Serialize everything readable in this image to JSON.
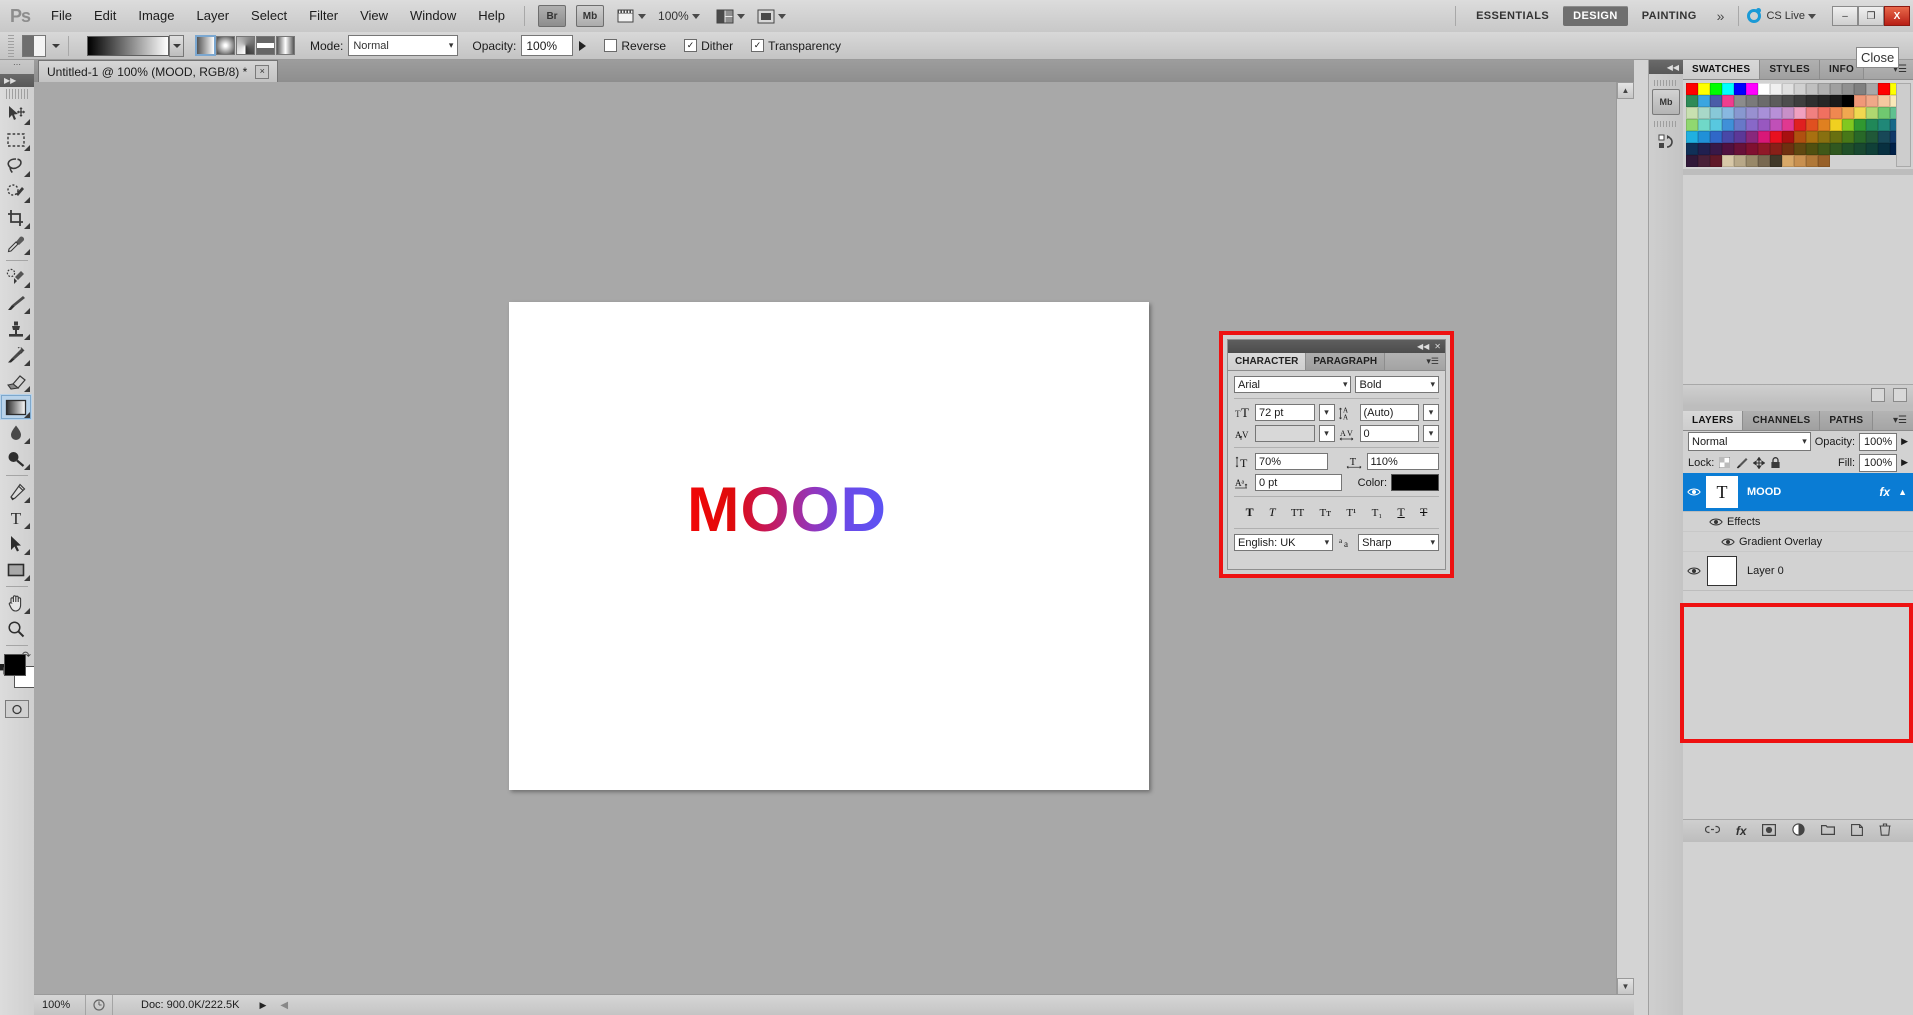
{
  "app": {
    "logo": "Ps",
    "menus": [
      "File",
      "Edit",
      "Image",
      "Layer",
      "Select",
      "Filter",
      "View",
      "Window",
      "Help"
    ],
    "bridge_label": "Br",
    "minibridge_label": "Mb",
    "zoom_level": "100%",
    "workspaces": [
      "ESSENTIALS",
      "DESIGN",
      "PAINTING"
    ],
    "workspace_active": "DESIGN",
    "workspace_more": "»",
    "cs_live": "CS Live",
    "win_minimize": "–",
    "win_restore": "❐",
    "win_close": "X",
    "tooltip_close": "Close"
  },
  "options_bar": {
    "mode_label": "Mode:",
    "mode_value": "Normal",
    "opacity_label": "Opacity:",
    "opacity_value": "100%",
    "reverse_label": "Reverse",
    "reverse_checked": false,
    "dither_label": "Dither",
    "dither_checked": true,
    "transparency_label": "Transparency",
    "transparency_checked": true,
    "gradient_types": [
      "linear-gradient",
      "radial-gradient",
      "angle-gradient",
      "reflected-gradient",
      "diamond-gradient"
    ],
    "gradient_type_selected": 0
  },
  "document": {
    "tab_title": "Untitled-1 @ 100% (MOOD, RGB/8) *",
    "tab_close": "×",
    "canvas_text": "MOOD",
    "gradient_start": "#f20707",
    "gradient_end": "#5b54f5"
  },
  "status_bar": {
    "zoom": "100%",
    "doc_info": "Doc: 900.0K/222.5K"
  },
  "toolbar": {
    "tools": [
      {
        "name": "move-tool",
        "selected": false
      },
      {
        "name": "rectangular-marquee-tool",
        "selected": false
      },
      {
        "name": "lasso-tool",
        "selected": false
      },
      {
        "name": "quick-selection-tool",
        "selected": false
      },
      {
        "name": "crop-tool",
        "selected": false
      },
      {
        "name": "eyedropper-tool",
        "selected": false
      },
      {
        "name": "spot-healing-brush-tool",
        "selected": false
      },
      {
        "name": "brush-tool",
        "selected": false
      },
      {
        "name": "clone-stamp-tool",
        "selected": false
      },
      {
        "name": "history-brush-tool",
        "selected": false
      },
      {
        "name": "eraser-tool",
        "selected": false
      },
      {
        "name": "gradient-tool",
        "selected": true
      },
      {
        "name": "blur-tool",
        "selected": false
      },
      {
        "name": "dodge-tool",
        "selected": false
      },
      {
        "name": "pen-tool",
        "selected": false
      },
      {
        "name": "horizontal-type-tool",
        "selected": false
      },
      {
        "name": "path-selection-tool",
        "selected": false
      },
      {
        "name": "rectangle-tool",
        "selected": false
      },
      {
        "name": "hand-tool",
        "selected": false
      },
      {
        "name": "zoom-tool",
        "selected": false
      }
    ],
    "foreground_color": "#000000",
    "background_color": "#ffffff"
  },
  "swatches_panel": {
    "tabs": [
      "SWATCHES",
      "STYLES",
      "INFO"
    ],
    "active_tab": "SWATCHES",
    "colors": [
      "#ff0000",
      "#ffff00",
      "#00ff00",
      "#00ffff",
      "#0000ff",
      "#ff00ff",
      "#ffffff",
      "#f0f0f0",
      "#e0e0e0",
      "#d0d0d0",
      "#c0c0c0",
      "#b0b0b0",
      "#a0a0a0",
      "#909090",
      "#808080",
      "#a8a8a8",
      "#ff0000",
      "#ffff00",
      "#2e8b57",
      "#3ba5e0",
      "#4a5ca8",
      "#ef3d8f",
      "#8c8c8c",
      "#7a7a7a",
      "#6b6b6b",
      "#5c5c5c",
      "#4d4d4d",
      "#3e3e3e",
      "#2f2f2f",
      "#262626",
      "#1a1a1a",
      "#000000",
      "#f09878",
      "#f0a888",
      "#f5c8a0",
      "#f8e8b8",
      "#c8e0b0",
      "#a8d8c8",
      "#88c8d8",
      "#88b8e0",
      "#8898d0",
      "#9890d0",
      "#a890d8",
      "#b890d8",
      "#c890c8",
      "#f0a0c0",
      "#f08080",
      "#f07060",
      "#f08850",
      "#f0a850",
      "#f0d850",
      "#b0d870",
      "#70c870",
      "#60c090",
      "#90d870",
      "#70d8c8",
      "#58c8e0",
      "#4090d8",
      "#6878c8",
      "#8868c8",
      "#9858c0",
      "#c050b8",
      "#e03890",
      "#e02020",
      "#e05020",
      "#e08020",
      "#f0d020",
      "#80c820",
      "#309830",
      "#208858",
      "#208878",
      "#186888",
      "#20b0e0",
      "#2090d8",
      "#3068c8",
      "#4848a8",
      "#5c3898",
      "#88287c",
      "#d81878",
      "#e81020",
      "#a81010",
      "#b05010",
      "#a87010",
      "#887010",
      "#687010",
      "#487818",
      "#286828",
      "#205838",
      "#184858",
      "#103868",
      "#103058",
      "#202050",
      "#381848",
      "#501040",
      "#681038",
      "#801030",
      "#901828",
      "#882018",
      "#703010",
      "#604810",
      "#505010",
      "#405818",
      "#305820",
      "#205028",
      "#184830",
      "#104038",
      "#083040",
      "#002048",
      "#301838",
      "#482038",
      "#601828",
      "#d8c8a8",
      "#b8a888",
      "#988868",
      "#786850",
      "#403828",
      "#d8a868",
      "#c89050",
      "#b07838",
      "#986028"
    ]
  },
  "layers_panel": {
    "tabs": [
      "LAYERS",
      "CHANNELS",
      "PATHS"
    ],
    "active_tab": "LAYERS",
    "blend_mode": "Normal",
    "opacity_label": "Opacity:",
    "opacity_value": "100%",
    "lock_label": "Lock:",
    "fill_label": "Fill:",
    "fill_value": "100%",
    "layers": [
      {
        "name": "MOOD",
        "type": "text",
        "selected": true,
        "visible": true,
        "has_fx": true,
        "fx_badge": "fx"
      },
      {
        "name": "Effects",
        "type": "effects-group",
        "selected": false,
        "visible": true
      },
      {
        "name": "Gradient Overlay",
        "type": "effect",
        "selected": false,
        "visible": true
      },
      {
        "name": "Layer 0",
        "type": "raster",
        "selected": false,
        "visible": true
      }
    ],
    "footer_icons": [
      "link-layers-icon",
      "add-layer-style-icon",
      "add-layer-mask-icon",
      "new-adjustment-layer-icon",
      "new-group-icon",
      "new-layer-icon",
      "delete-layer-icon"
    ]
  },
  "character_panel": {
    "tabs": [
      "CHARACTER",
      "PARAGRAPH"
    ],
    "active_tab": "CHARACTER",
    "font_family": "Arial",
    "font_style": "Bold",
    "font_size": "72 pt",
    "leading": "(Auto)",
    "kerning": "",
    "tracking": "0",
    "vertical_scale": "70%",
    "horizontal_scale": "110%",
    "baseline_shift": "0 pt",
    "color_label": "Color:",
    "color_value": "#000000",
    "language": "English: UK",
    "antialias_label": "aa",
    "antialias": "Sharp",
    "style_buttons": [
      "faux-bold",
      "faux-italic",
      "all-caps",
      "small-caps",
      "superscript",
      "subscript",
      "underline",
      "strikethrough"
    ],
    "style_glyphs": [
      "T",
      "T",
      "TT",
      "Tт",
      "T¹",
      "T₁",
      "T",
      "T"
    ]
  }
}
